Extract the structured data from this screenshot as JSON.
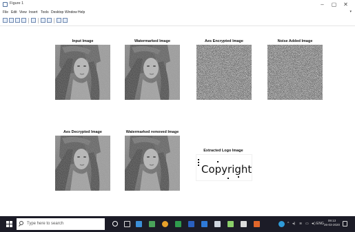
{
  "window": {
    "title": "Figure 1"
  },
  "menu": [
    "File",
    "Edit",
    "View",
    "Insert",
    "Tools",
    "Desktop",
    "Window",
    "Help"
  ],
  "panels": {
    "input": "Input Image",
    "watermarked": "Watermarked Image",
    "aes_encrypted": "Aes Encrypted Image",
    "noise_added": "Noise Added Image",
    "aes_decrypted": "Aes Decrypted Image",
    "watermark_removed": "Watermarked removed Image",
    "extracted_logo": "Extracted Logo Image"
  },
  "logo_text": "Copyright",
  "taskbar": {
    "search_placeholder": "Type here to search",
    "tray_lang": "ENG",
    "clock_time": "09:13",
    "clock_date": "26-03-2020"
  },
  "colors": {
    "taskbar": "#1c1c27",
    "accent": "#2f7ad8"
  }
}
